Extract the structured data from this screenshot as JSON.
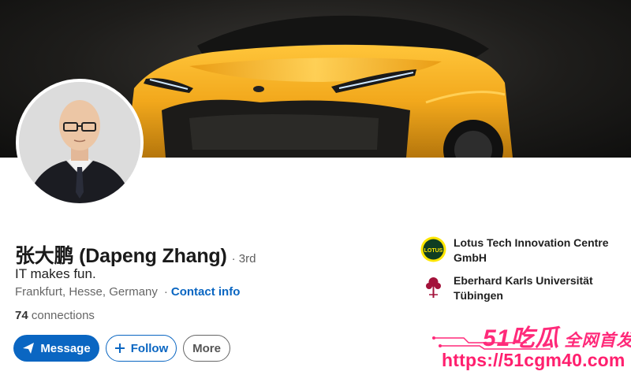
{
  "profile": {
    "name": "张大鹏 (Dapeng Zhang)",
    "degree": "· 3rd",
    "headline": "IT makes fun.",
    "location": "Frankfurt, Hesse, Germany",
    "contact_info_label": "Contact info",
    "connections_count": "74",
    "connections_label": "connections"
  },
  "actions": {
    "message_label": "Message",
    "follow_label": "Follow",
    "more_label": "More"
  },
  "experience": {
    "company": "Lotus Tech Innovation Centre GmbH",
    "logo_text": "LOTUS"
  },
  "education": {
    "school": "Eberhard Karls Universität Tübingen"
  },
  "watermark": {
    "brand": "51吃瓜",
    "tagline": "全网首发",
    "url": "https://51cgm40.com"
  },
  "colors": {
    "accent": "#0a66c2",
    "car": "#f2a81c",
    "lotus_yellow": "#ffe600",
    "watermark": "#ff2a7a"
  }
}
